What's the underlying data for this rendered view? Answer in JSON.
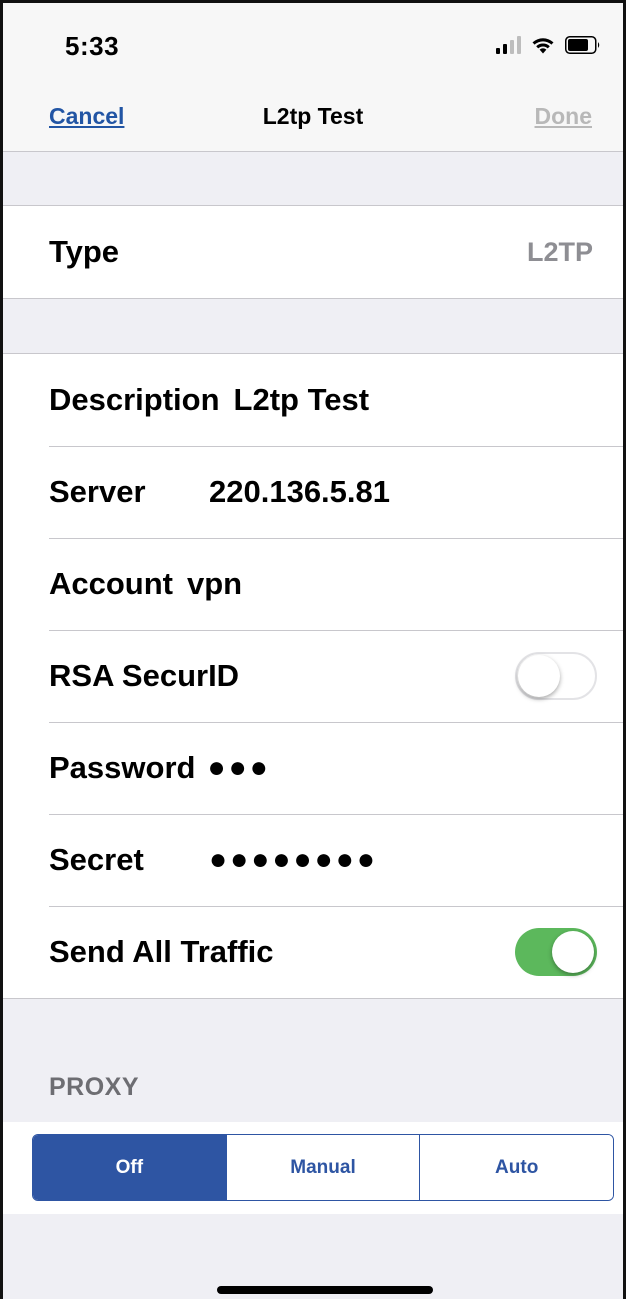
{
  "status_bar": {
    "time": "5:33",
    "icons": [
      "cellular-signal-icon",
      "wifi-icon",
      "battery-icon"
    ]
  },
  "nav": {
    "cancel_label": "Cancel",
    "title": "L2tp Test",
    "done_label": "Done"
  },
  "type_row": {
    "label": "Type",
    "value": "L2TP"
  },
  "fields": {
    "description": {
      "label": "Description",
      "value": "L2tp Test"
    },
    "server": {
      "label": "Server",
      "value": "220.136.5.81"
    },
    "account": {
      "label": "Account",
      "value": "vpn"
    },
    "rsa_securid": {
      "label": "RSA SecurID",
      "on": false
    },
    "password": {
      "label": "Password",
      "value": "●●●"
    },
    "secret": {
      "label": "Secret",
      "value": "●●●●●●●●"
    },
    "send_all_traffic": {
      "label": "Send All Traffic",
      "on": true
    }
  },
  "proxy": {
    "header": "PROXY",
    "options": [
      "Off",
      "Manual",
      "Auto"
    ],
    "selected": "Off"
  },
  "colors": {
    "accent": "#2e55a3",
    "switch_on": "#5cb85c",
    "done_disabled": "#b8b8b8",
    "secondary_text": "#8e8e93",
    "grouped_background": "#efeff4"
  }
}
